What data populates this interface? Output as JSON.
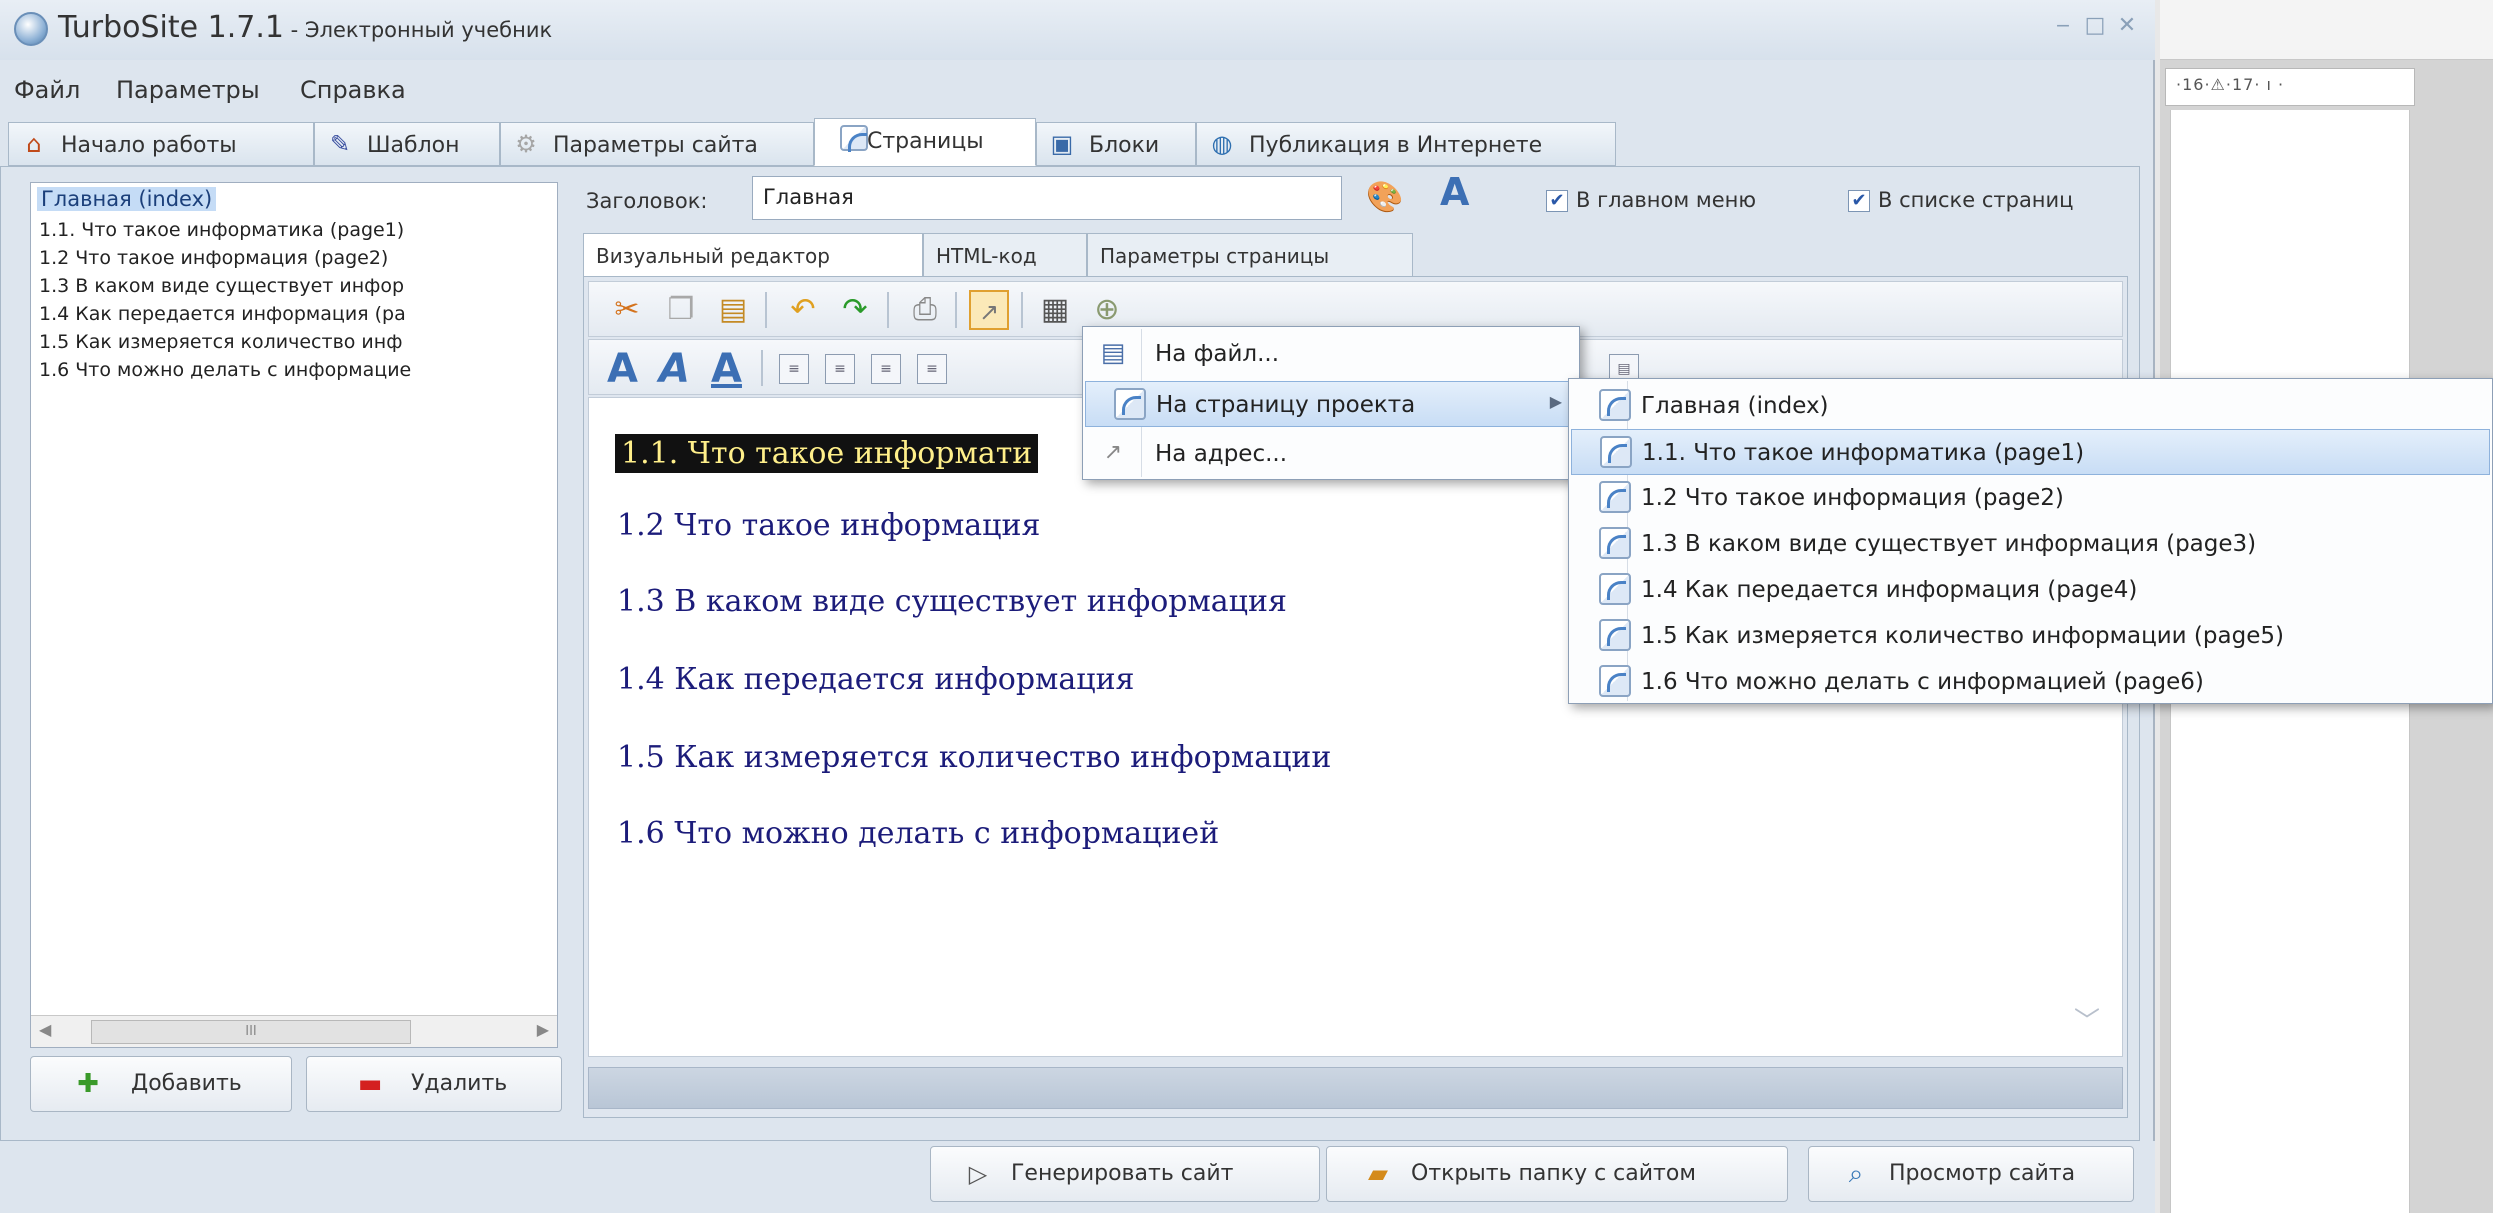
{
  "window": {
    "title": "TurboSite 1.7.1",
    "subtitle": " - Электронный учебник",
    "controls": [
      "‒",
      "□",
      "✕"
    ]
  },
  "menubar": [
    "Файл",
    "Параметры",
    "Справка"
  ],
  "tabs": [
    {
      "label": "Начало работы",
      "icon": "home-icon"
    },
    {
      "label": "Шаблон",
      "icon": "brush-icon"
    },
    {
      "label": "Параметры сайта",
      "icon": "gear-icon"
    },
    {
      "label": "Страницы",
      "icon": "page-icon",
      "active": true
    },
    {
      "label": "Блоки",
      "icon": "block-icon"
    },
    {
      "label": "Публикация в Интернете",
      "icon": "globe-icon"
    }
  ],
  "pages_list": {
    "items": [
      "Главная (index)",
      "1.1. Что такое информатика (page1)",
      "1.2 Что такое информация (page2)",
      "1.3 В каком виде существует инфор",
      "1.4 Как передается информация (pa",
      "1.5 Как измеряется количество инф",
      "1.6 Что можно делать с информацие"
    ],
    "selected_index": 0,
    "scroll_thumb": "III"
  },
  "buttons": {
    "add": "Добавить",
    "delete": "Удалить",
    "generate": "Генерировать сайт",
    "open_folder": "Открыть папку с сайтом",
    "preview": "Просмотр сайта"
  },
  "heading": {
    "label": "Заголовок:",
    "value": "Главная"
  },
  "checkboxes": {
    "main_menu": {
      "label": "В главном меню",
      "checked": true
    },
    "page_list": {
      "label": "В списке страниц",
      "checked": true
    }
  },
  "sub_tabs": [
    "Визуальный редактор",
    "HTML-код",
    "Параметры страницы"
  ],
  "editor_lines": [
    "1.1. Что такое информати",
    "1.2 Что такое информация",
    "1.3 В каком виде существует информация",
    "1.4 Как передается информация",
    "1.5 Как измеряется количество информации",
    "1.6 Что можно делать с информацией"
  ],
  "link_menu": {
    "items": [
      {
        "label": "На файл...",
        "icon": "file-icon"
      },
      {
        "label": "На страницу проекта",
        "icon": "page-icon",
        "highlighted": true,
        "has_submenu": true
      },
      {
        "label": "На адрес...",
        "icon": "link-icon"
      }
    ]
  },
  "submenu": {
    "items": [
      "Главная (index)",
      "1.1. Что такое информатика (page1)",
      "1.2 Что такое информация (page2)",
      "1.3 В каком виде существует информация (page3)",
      "1.4 Как передается информация (page4)",
      "1.5 Как измеряется количество информации (page5)",
      "1.6 Что можно делать с информацией (page6)"
    ],
    "highlighted_index": 1
  },
  "background_ruler": "·16·⚠·17· ı ·",
  "colors": {
    "window_bg": "#dde5ee",
    "selection": "#c5dcf6",
    "editor_text": "#1c1c7a",
    "highlight_text_bg": "#111111",
    "highlight_text_fg": "#ffef8a"
  }
}
